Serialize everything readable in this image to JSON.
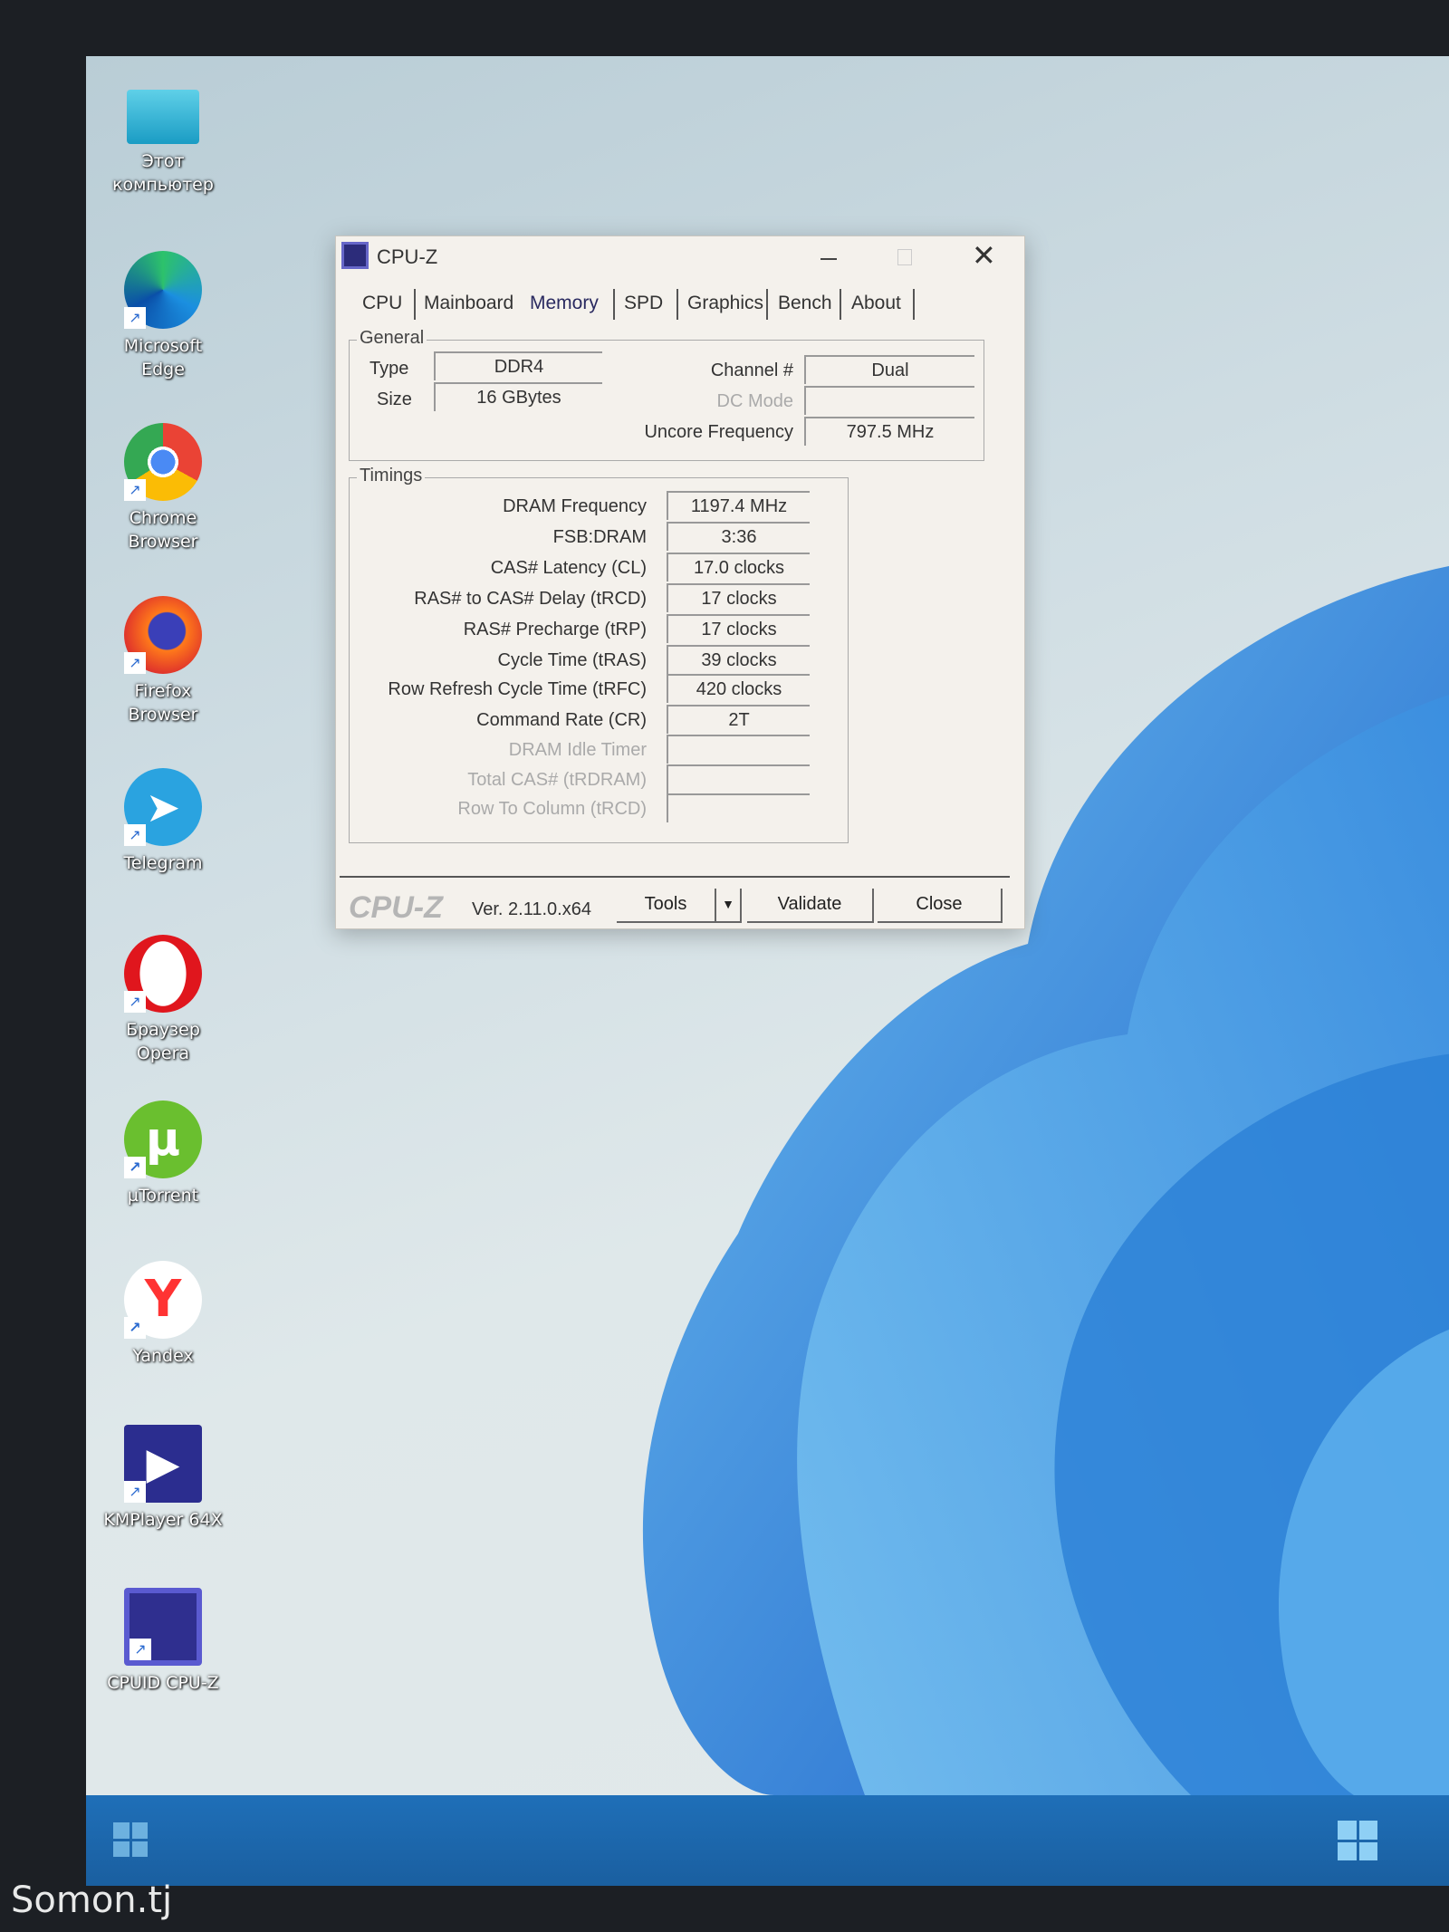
{
  "desktop": {
    "icons": [
      {
        "label": "Этот компьютер",
        "icon": "monitor-icon"
      },
      {
        "label": "Microsoft Edge",
        "icon": "edge-icon"
      },
      {
        "label": "Chrome Browser",
        "icon": "chrome-icon"
      },
      {
        "label": "Firefox Browser",
        "icon": "firefox-icon"
      },
      {
        "label": "Telegram",
        "icon": "telegram-icon"
      },
      {
        "label": "Браузер Opera",
        "icon": "opera-icon"
      },
      {
        "label": "µTorrent",
        "icon": "utorrent-icon"
      },
      {
        "label": "Yandex",
        "icon": "yandex-icon"
      },
      {
        "label": "KMPlayer 64X",
        "icon": "kmplayer-icon"
      },
      {
        "label": "CPUID CPU-Z",
        "icon": "cpuz-icon"
      }
    ]
  },
  "window": {
    "title": "CPU-Z",
    "tabs": [
      "CPU",
      "Mainboard",
      "Memory",
      "SPD",
      "Graphics",
      "Bench",
      "About"
    ],
    "active_tab": "Memory",
    "general": {
      "title": "General",
      "type_label": "Type",
      "type_value": "DDR4",
      "size_label": "Size",
      "size_value": "16 GBytes",
      "channel_label": "Channel #",
      "channel_value": "Dual",
      "dc_mode_label": "DC Mode",
      "dc_mode_value": "",
      "uncore_label": "Uncore Frequency",
      "uncore_value": "797.5 MHz"
    },
    "timings": {
      "title": "Timings",
      "rows": [
        {
          "label": "DRAM Frequency",
          "value": "1197.4 MHz",
          "enabled": true
        },
        {
          "label": "FSB:DRAM",
          "value": "3:36",
          "enabled": true
        },
        {
          "label": "CAS# Latency (CL)",
          "value": "17.0 clocks",
          "enabled": true
        },
        {
          "label": "RAS# to CAS# Delay (tRCD)",
          "value": "17 clocks",
          "enabled": true
        },
        {
          "label": "RAS# Precharge (tRP)",
          "value": "17 clocks",
          "enabled": true
        },
        {
          "label": "Cycle Time (tRAS)",
          "value": "39 clocks",
          "enabled": true
        },
        {
          "label": "Row Refresh Cycle Time (tRFC)",
          "value": "420 clocks",
          "enabled": true
        },
        {
          "label": "Command Rate (CR)",
          "value": "2T",
          "enabled": true
        },
        {
          "label": "DRAM Idle Timer",
          "value": "",
          "enabled": false
        },
        {
          "label": "Total CAS# (tRDRAM)",
          "value": "",
          "enabled": false
        },
        {
          "label": "Row To Column (tRCD)",
          "value": "",
          "enabled": false
        }
      ]
    },
    "footer": {
      "logo": "CPU-Z",
      "version": "Ver. 2.11.0.x64",
      "tools_label": "Tools",
      "validate_label": "Validate",
      "close_label": "Close"
    }
  },
  "watermark": "Somon.tj",
  "colors": {
    "taskbar": "#1f6fb8",
    "wallpaper_accent": "#2f8fdc"
  }
}
